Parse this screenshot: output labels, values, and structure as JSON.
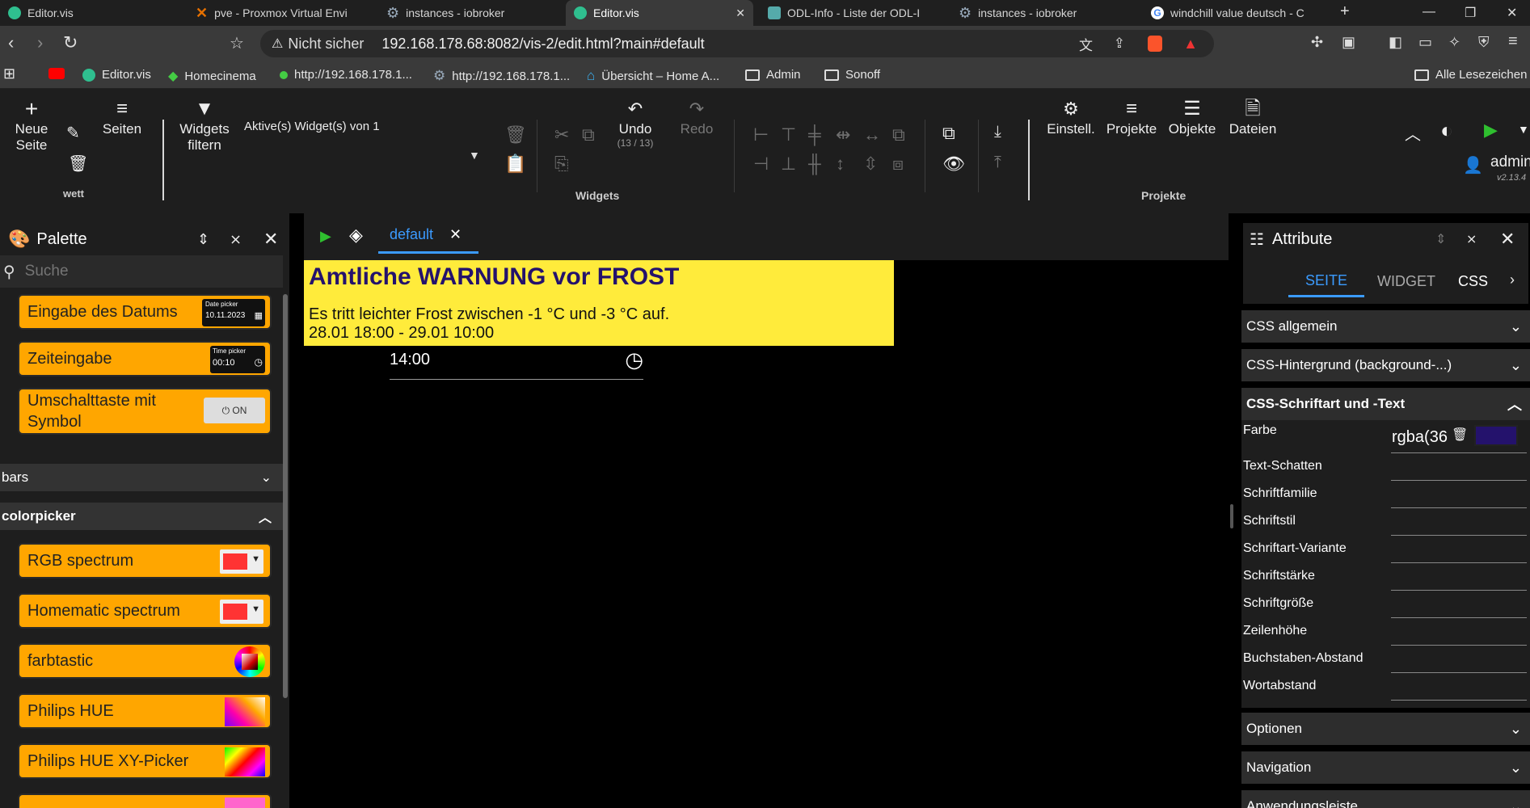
{
  "browser": {
    "tabs": [
      {
        "title": "Editor.vis",
        "icon": "vis-icon",
        "color": "#2fbf8f"
      },
      {
        "title": "pve - Proxmox Virtual Envi",
        "icon": "proxmox-icon",
        "color": "#e57000"
      },
      {
        "title": "instances - iobroker",
        "icon": "gear-icon",
        "color": "#9ab"
      },
      {
        "title": "Editor.vis",
        "icon": "vis-icon",
        "color": "#2fbf8f",
        "active": true
      },
      {
        "title": "ODL-Info - Liste der ODL-I",
        "icon": "bfs-icon",
        "color": "#5aa"
      },
      {
        "title": "instances - iobroker",
        "icon": "gear-icon",
        "color": "#9ab"
      },
      {
        "title": "windchill value deutsch - C",
        "icon": "google-icon",
        "color": "#4285f4"
      }
    ],
    "security_label": "Nicht sicher",
    "url": "192.168.178.68:8082/vis-2/edit.html?main#default",
    "bookmarks": [
      {
        "label": "",
        "icon": "youtube-icon"
      },
      {
        "label": "Editor.vis",
        "icon": "vis-icon"
      },
      {
        "label": "Homecinema",
        "icon": "kodi-icon"
      },
      {
        "label": "http://192.168.178.1...",
        "icon": "dot-icon"
      },
      {
        "label": "http://192.168.178.1...",
        "icon": "gear-icon"
      },
      {
        "label": "Übersicht – Home A...",
        "icon": "home-assistant-icon"
      },
      {
        "label": "Admin",
        "icon": "folder-icon"
      },
      {
        "label": "Sonoff",
        "icon": "folder-icon"
      }
    ],
    "all_bookmarks": "Alle Lesezeichen"
  },
  "toolbar": {
    "new_page": "Neue Seite",
    "pages": "Seiten",
    "page_name": "wett",
    "filter_widgets": "Widgets filtern",
    "active_widgets": "Aktive(s) Widget(s) von 1",
    "undo": "Undo",
    "undo_count": "(13 / 13)",
    "redo": "Redo",
    "widgets_section": "Widgets",
    "settings": "Einstell.",
    "projects": "Projekte",
    "objects": "Objekte",
    "files": "Dateien",
    "projects_section": "Projekte",
    "user": "admin",
    "version": "v2.13.4"
  },
  "palette": {
    "title": "Palette",
    "search_placeholder": "Suche",
    "items_top": [
      {
        "label": "Eingabe des Datums",
        "preview_caption": "Date picker",
        "preview_value": "10.11.2023"
      },
      {
        "label": "Zeiteingabe",
        "preview_caption": "Time picker",
        "preview_value": "00:10"
      },
      {
        "label": "Umschalttaste mit Symbol",
        "preview_value": "ON"
      }
    ],
    "groups": [
      {
        "name": "bars",
        "expanded": false
      },
      {
        "name": "colorpicker",
        "expanded": true
      }
    ],
    "colorpicker_items": [
      {
        "label": "RGB spectrum"
      },
      {
        "label": "Homematic spectrum"
      },
      {
        "label": "farbtastic"
      },
      {
        "label": "Philips HUE"
      },
      {
        "label": "Philips HUE XY-Picker"
      }
    ]
  },
  "canvas": {
    "view_tab": "default",
    "warning": {
      "title": "Amtliche WARNUNG vor FROST",
      "text": "Es tritt leichter Frost zwischen -1 °C und -3 °C auf.",
      "period": "28.01 18:00 - 29.01 10:00",
      "bg_color": "#ffeb3b",
      "title_color": "#24126c"
    },
    "time_value": "14:00"
  },
  "attributes": {
    "title": "Attribute",
    "tabs": [
      "SEITE",
      "WIDGET",
      "CSS"
    ],
    "sections": {
      "css_general": "CSS allgemein",
      "css_background": "CSS-Hintergrund (background-...)",
      "css_font": "CSS-Schriftart und -Text",
      "options": "Optionen",
      "navigation": "Navigation",
      "app_bar": "Anwendungsleiste"
    },
    "fields": {
      "color": "Farbe",
      "color_value": "rgba(36",
      "text_shadow": "Text-Schatten",
      "font_family": "Schriftfamilie",
      "font_style": "Schriftstil",
      "font_variant": "Schriftart-Variante",
      "font_weight": "Schriftstärke",
      "font_size": "Schriftgröße",
      "line_height": "Zeilenhöhe",
      "letter_spacing": "Buchstaben-Abstand",
      "word_spacing": "Wortabstand"
    },
    "color_swatch": "#24126c"
  },
  "colors": {
    "accent": "#3b9bff",
    "play_green": "#2fbf2f",
    "widget_orange": "#ffa600"
  }
}
